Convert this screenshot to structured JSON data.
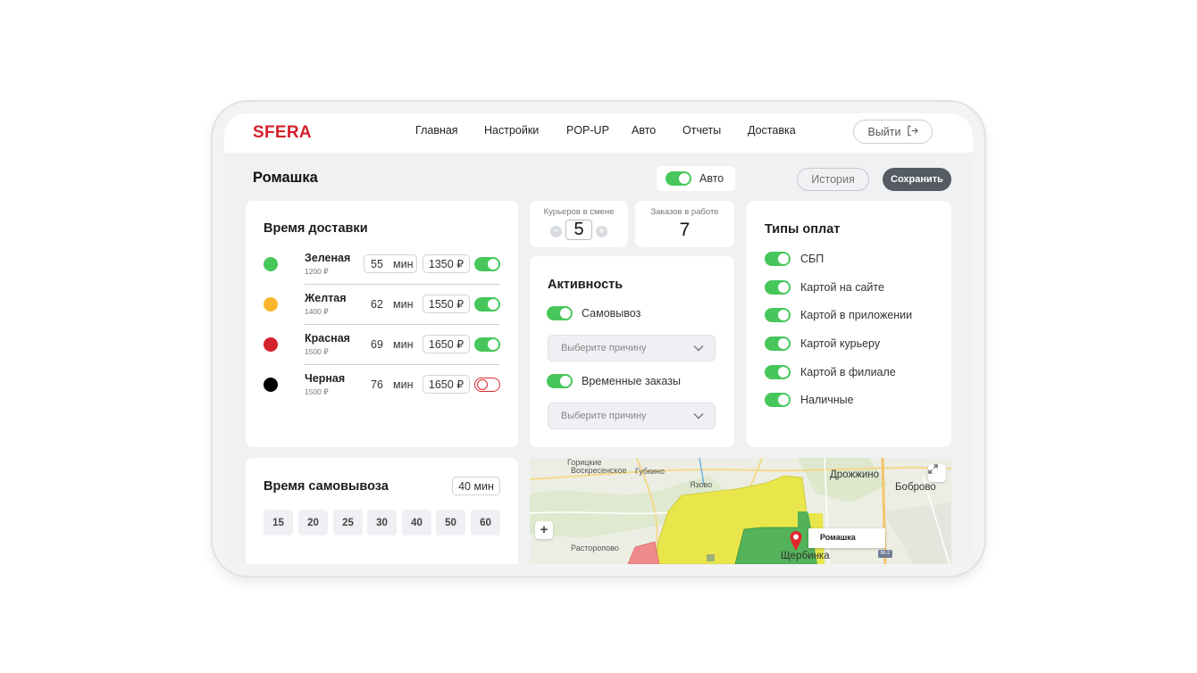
{
  "app": {
    "logo": "SFERA"
  },
  "nav": {
    "items": [
      "Главная",
      "Настройки",
      "POP-UP",
      "Авто",
      "Отчеты",
      "Доставка"
    ],
    "logout_label": "Выйти"
  },
  "header": {
    "title": "Ромашка",
    "auto_label": "Авто",
    "auto_enabled": true,
    "history_label": "История",
    "save_label": "Сохранить"
  },
  "delivery": {
    "title": "Время доставки",
    "minutes_unit": "мин",
    "zones": [
      {
        "name": "Зеленая",
        "sub": "1200 ₽",
        "minutes": "55",
        "price": "1350 ₽",
        "color": "#47c75b",
        "enabled": true
      },
      {
        "name": "Желтая",
        "sub": "1400 ₽",
        "minutes": "62",
        "price": "1550 ₽",
        "color": "#f9b52a",
        "enabled": true
      },
      {
        "name": "Красная",
        "sub": "1500 ₽",
        "minutes": "69",
        "price": "1650 ₽",
        "color": "#d41f2c",
        "enabled": true
      },
      {
        "name": "Черная",
        "sub": "1500 ₽",
        "minutes": "76",
        "price": "1650 ₽",
        "color": "#000000",
        "enabled": false
      }
    ]
  },
  "pickup": {
    "title": "Время самовывоза",
    "current": "40 мин",
    "options": [
      "15",
      "20",
      "25",
      "30",
      "40",
      "50",
      "60"
    ]
  },
  "couriers": {
    "label": "Курьеров в смене",
    "value": "5",
    "minus": "−",
    "plus": "+"
  },
  "orders": {
    "label": "Заказов в работе",
    "value": "7"
  },
  "activity": {
    "title": "Активность",
    "pickup_label": "Самовывоз",
    "pickup_enabled": true,
    "pickup_reason_placeholder": "Выберите причину",
    "timed_label": "Временные заказы",
    "timed_enabled": true,
    "timed_reason_placeholder": "Выберите причину"
  },
  "payments": {
    "title": "Типы оплат",
    "items": [
      {
        "label": "СБП",
        "enabled": true
      },
      {
        "label": "Картой на сайте",
        "enabled": true
      },
      {
        "label": "Картой в приложении",
        "enabled": true
      },
      {
        "label": "Картой курьеру",
        "enabled": true
      },
      {
        "label": "Картой в филиале",
        "enabled": true
      },
      {
        "label": "Наличные",
        "enabled": true
      }
    ]
  },
  "map": {
    "labels": [
      "Горицкие",
      "Воскресенское",
      "Губкино",
      "Язово",
      "Дрожжино",
      "Боброво",
      "Расторопово",
      "Щербинка"
    ],
    "marker_label": "Ромашка",
    "road_sign": "М-2",
    "zoom_in": "+",
    "zone_colors": {
      "yellow": "#e8e64a",
      "green": "#54b35a",
      "red": "#f08a8a"
    }
  }
}
